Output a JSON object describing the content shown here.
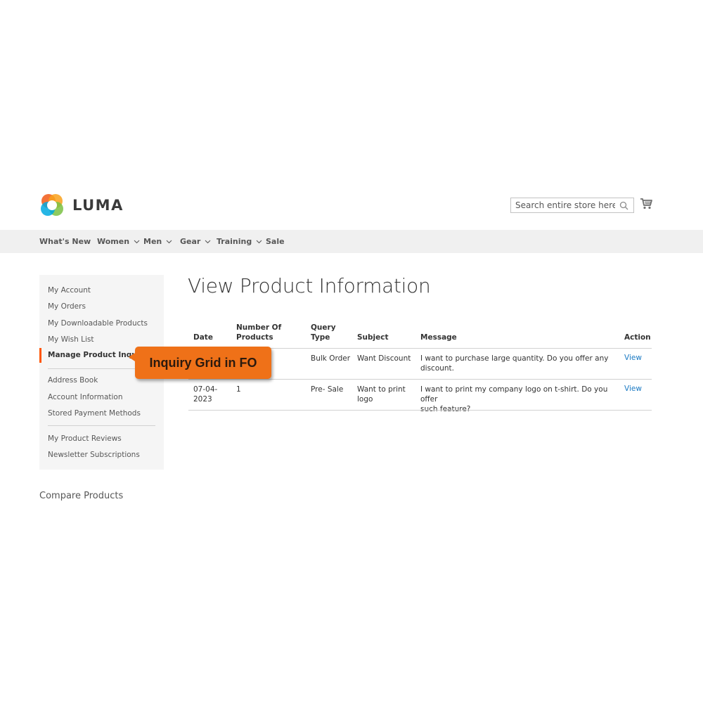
{
  "header": {
    "logo_text": "LUMA",
    "search_placeholder": "Search entire store here..."
  },
  "nav": {
    "items": [
      {
        "label": "What's New",
        "dropdown": false
      },
      {
        "label": "Women",
        "dropdown": true
      },
      {
        "label": "Men",
        "dropdown": true
      },
      {
        "label": "Gear",
        "dropdown": true
      },
      {
        "label": "Training",
        "dropdown": true
      },
      {
        "label": "Sale",
        "dropdown": false
      }
    ]
  },
  "sidebar": {
    "items": [
      {
        "label": "My Account"
      },
      {
        "label": "My Orders"
      },
      {
        "label": "My Downloadable Products"
      },
      {
        "label": "My Wish List"
      },
      {
        "label": "Manage Product Inquiry",
        "active": true
      },
      {
        "label": "Address Book"
      },
      {
        "label": "Account Information"
      },
      {
        "label": "Stored Payment Methods"
      },
      {
        "label": "My Product Reviews"
      },
      {
        "label": "Newsletter Subscriptions"
      }
    ],
    "accent_color": "#ff5501"
  },
  "compare_label": "Compare Products",
  "main": {
    "title": "View Product Information",
    "table": {
      "headers": {
        "date": "Date",
        "number_line1": "Number Of",
        "number_line2": "Products",
        "query_line1": "Query",
        "query_line2": "Type",
        "subject": "Subject",
        "message": "Message",
        "action": "Action"
      },
      "rows": [
        {
          "date_line1": "",
          "date_line2": "",
          "number": "",
          "query_type": "Bulk Order",
          "subject_line1": "Want Discount",
          "subject_line2": "",
          "message_line1": "I want to purchase large quantity. Do you offer any discount.",
          "message_line2": "",
          "action": "View"
        },
        {
          "date_line1": "07-04-",
          "date_line2": "2023",
          "number": "1",
          "query_type": "Pre- Sale",
          "subject_line1": "Want to print",
          "subject_line2": "logo",
          "message_line1": "I want to print my company logo on t-shirt. Do you offer",
          "message_line2": "such feature?",
          "action": "View"
        }
      ]
    }
  },
  "callout": {
    "text": "Inquiry Grid in FO",
    "color": "#ef7118"
  }
}
